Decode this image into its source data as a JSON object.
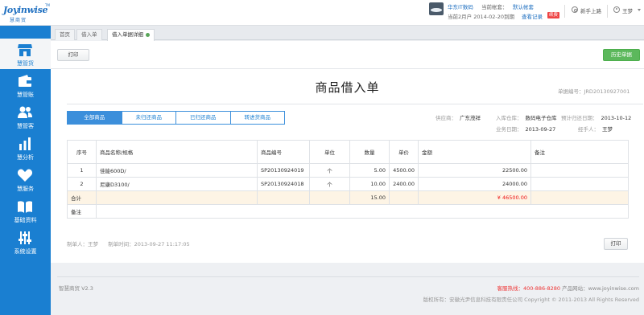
{
  "brand": {
    "logo_text": "Joyinwise",
    "logo_tm": "TM",
    "logo_cn": "慧商贸"
  },
  "header": {
    "store_name": "华东IT数码",
    "current_account_label": "当前帐套：",
    "current_account_value": "默认帐套",
    "period_text": "当前2月户",
    "period_date": "2014-02-20到期",
    "login_log": "查看记录",
    "status_tag": "续费",
    "newbie_label": "新手上路",
    "user_name": "王梦"
  },
  "sidebar": {
    "items": [
      {
        "label": "慧管货",
        "icon": "store-icon"
      },
      {
        "label": "慧管账",
        "icon": "wallet-icon"
      },
      {
        "label": "慧管客",
        "icon": "users-icon"
      },
      {
        "label": "慧分析",
        "icon": "bar-chart-icon"
      },
      {
        "label": "慧服务",
        "icon": "heart-icon"
      },
      {
        "label": "基础资料",
        "icon": "book-icon"
      },
      {
        "label": "系统设置",
        "icon": "sliders-icon"
      }
    ]
  },
  "tabs": [
    {
      "label": "首页"
    },
    {
      "label": "借入单"
    },
    {
      "label": "借入单据详细"
    }
  ],
  "toolbar": {
    "print_label": "打印",
    "history_label": "历史单据"
  },
  "document": {
    "title": "商品借入单",
    "doc_no_label": "单据编号：",
    "doc_no": "JRD20130927001",
    "filter_tabs": [
      "全部商品",
      "未归还商品",
      "已归还商品",
      "转进货商品"
    ],
    "supplier_label": "供应商：",
    "supplier": "广东茂祥",
    "warehouse_label": "入库仓库：",
    "warehouse": "数码电子仓库",
    "return_date_label": "预计归还日期：",
    "return_date": "2013-10-12",
    "biz_date_label": "业务日期：",
    "biz_date": "2013-09-27",
    "handler_label": "经手人：",
    "handler": "王梦"
  },
  "table": {
    "headers": [
      "序号",
      "商品名称/规格",
      "商品编号",
      "单位",
      "数量",
      "单价",
      "金额",
      "备注"
    ],
    "rows": [
      [
        "1",
        "佳能600D/",
        "SP20130924019",
        "个",
        "5.00",
        "4500.00",
        "22500.00",
        ""
      ],
      [
        "2",
        "尼康D3100/",
        "SP20130924018",
        "个",
        "10.00",
        "2400.00",
        "24000.00",
        ""
      ]
    ],
    "total_label": "合计",
    "total_qty": "15.00",
    "total_amount": "¥ 46500.00",
    "remark_label": "备注"
  },
  "doc_footer": {
    "creator": "制单人：王梦",
    "created_time": "制单时间：2013-09-27 11:17:05",
    "print_label": "打印"
  },
  "page_footer": {
    "version": "智慧商贸 V2.3",
    "hotline_label": "客服热线：",
    "hotline": "400-886-8280",
    "website": "产品网站：www.joyinwise.com",
    "copyright": "版权所有：安徽光尹信息科技有限责任公司 Copyright © 2011-2013 All Rights Reserved"
  },
  "colors": {
    "primary": "#1a7fd1",
    "green": "#5cb85c",
    "red": "#e11111",
    "total_row": "#fdf4e5"
  }
}
